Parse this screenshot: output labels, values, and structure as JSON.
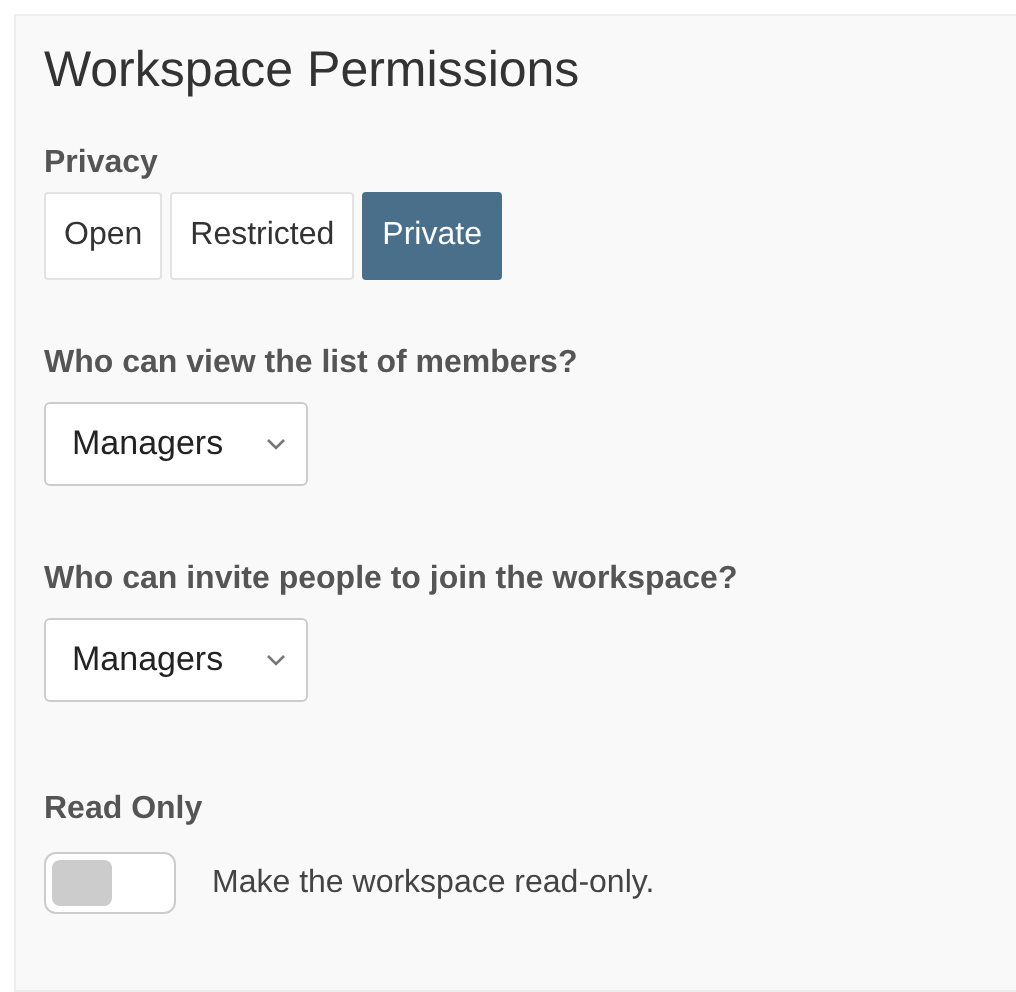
{
  "title": "Workspace Permissions",
  "privacy": {
    "label": "Privacy",
    "options": [
      {
        "label": "Open",
        "selected": false
      },
      {
        "label": "Restricted",
        "selected": false
      },
      {
        "label": "Private",
        "selected": true
      }
    ]
  },
  "selects": [
    {
      "label": "Who can view the list of members?",
      "value": "Managers"
    },
    {
      "label": "Who can invite people to join the workspace?",
      "value": "Managers"
    }
  ],
  "read_only": {
    "label": "Read Only",
    "on": false,
    "description": "Make the workspace read-only."
  }
}
